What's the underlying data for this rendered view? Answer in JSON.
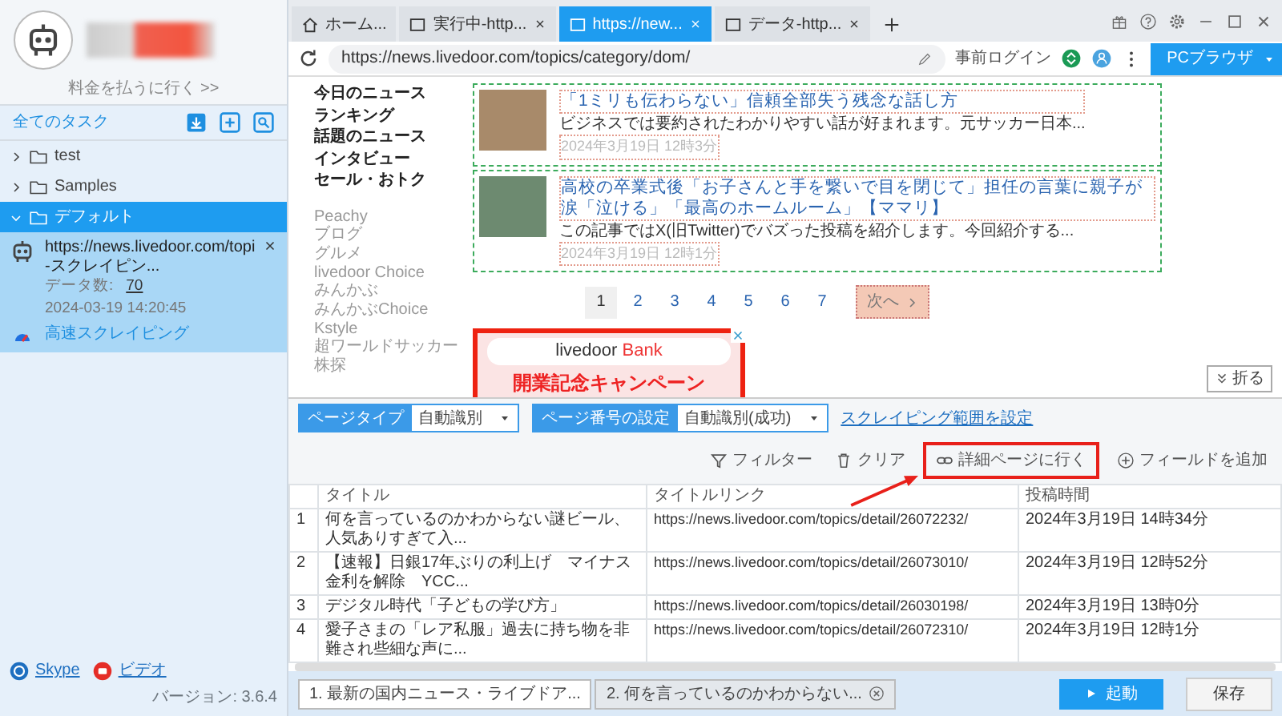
{
  "sidebar": {
    "pay_link": "料金を払うに行く >>",
    "all_tasks": "全てのタスク",
    "folders": [
      {
        "name": "test",
        "expanded": false,
        "selected": false
      },
      {
        "name": "Samples",
        "expanded": false,
        "selected": false
      },
      {
        "name": "デフォルト",
        "expanded": true,
        "selected": true,
        "tasks": [
          {
            "title": "https://news.livedoor.com/topi-スクレイピン...",
            "data_label": "データ数:",
            "data_count": "70",
            "time": "2024-03-19 14:20:45",
            "mode": "高速スクレイピング"
          }
        ]
      }
    ],
    "footer_links": [
      {
        "kind": "skype",
        "label": "Skype"
      },
      {
        "kind": "video",
        "label": "ビデオ"
      }
    ],
    "version": "バージョン: 3.6.4"
  },
  "browser_tabs": [
    {
      "kind": "home",
      "label": "ホーム...",
      "selected": false,
      "closable": false
    },
    {
      "kind": "page",
      "label": "実行中-http...",
      "selected": false,
      "closable": true
    },
    {
      "kind": "page",
      "label": "https://new...",
      "selected": true,
      "closable": true
    },
    {
      "kind": "page",
      "label": "データ-http...",
      "selected": false,
      "closable": true
    }
  ],
  "address_bar": {
    "url": "https://news.livedoor.com/topics/category/dom/",
    "prelogin": "事前ログイン",
    "browser_button": "PCブラウザ"
  },
  "webpage": {
    "nav_main": [
      "今日のニュース",
      "ランキング",
      "話題のニュース",
      "インタビュー",
      "セール・おトク"
    ],
    "nav_sub": [
      "Peachy",
      "ブログ",
      "グルメ",
      "livedoor Choice",
      "みんかぶ",
      "みんかぶChoice",
      "Kstyle",
      "超ワールドサッカー",
      "株探"
    ],
    "articles": [
      {
        "title": "「1ミリも伝わらない」信頼全部失う残念な話し方",
        "snippet": "ビジネスでは要約されたわかりやすい話が好まれます。元サッカー日本...",
        "date": "2024年3月19日 12時3分"
      },
      {
        "title": "高校の卒業式後「お子さんと手を繋いで目を閉じて」担任の言葉に親子が涙「泣ける」「最高のホームルーム」【ママリ】",
        "snippet": "この記事ではX(旧Twitter)でバズった投稿を紹介します。今回紹介する...",
        "date": "2024年3月19日 12時1分"
      }
    ],
    "pagination": {
      "pages": [
        {
          "label": "1",
          "selected": true
        },
        {
          "label": "2",
          "selected": false
        },
        {
          "label": "3",
          "selected": false
        },
        {
          "label": "4",
          "selected": false
        },
        {
          "label": "5",
          "selected": false
        },
        {
          "label": "6",
          "selected": false
        },
        {
          "label": "7",
          "selected": false
        }
      ],
      "next": "次へ"
    },
    "ad": {
      "brand_left": "livedoor",
      "brand_right": "Bank",
      "headline": "開業記念キャンペーン"
    }
  },
  "collapse_button": "折る",
  "toolbar": {
    "selects": [
      {
        "label": "ページタイプ",
        "value": "自動識別"
      },
      {
        "label": "ページ番号の設定",
        "value": "自動識別(成功)"
      }
    ],
    "range_link": "スクレイピング範囲を設定",
    "actions": [
      {
        "kind": "filter",
        "label": "フィルター",
        "highlighted": false
      },
      {
        "kind": "clear",
        "label": "クリア",
        "highlighted": false
      },
      {
        "kind": "detail",
        "label": "詳細ページに行く",
        "highlighted": true
      },
      {
        "kind": "add_field",
        "label": "フィールドを追加",
        "highlighted": false
      }
    ]
  },
  "table": {
    "columns": [
      "タイトル",
      "タイトルリンク",
      "投稿時間"
    ],
    "rows": [
      {
        "index": "1",
        "title": "何を言っているのかわからない謎ビール、人気ありすぎて入...",
        "link": "https://news.livedoor.com/topics/detail/26072232/",
        "time": "2024年3月19日 14時34分"
      },
      {
        "index": "2",
        "title": "【速報】日銀17年ぶりの利上げ　マイナス金利を解除　YCC...",
        "link": "https://news.livedoor.com/topics/detail/26073010/",
        "time": "2024年3月19日 12時52分"
      },
      {
        "index": "3",
        "title": "デジタル時代「子どもの学び方」",
        "link": "https://news.livedoor.com/topics/detail/26030198/",
        "time": "2024年3月19日 13時0分"
      },
      {
        "index": "4",
        "title": "愛子さまの「レア私服」過去に持ち物を非難され些細な声に...",
        "link": "https://news.livedoor.com/topics/detail/26072310/",
        "time": "2024年3月19日 12時1分"
      }
    ]
  },
  "result_tabs": [
    {
      "label": "1. 最新の国内ニュース・ライブドア...",
      "selected": true,
      "closable": false
    },
    {
      "label": "2. 何を言っているのかわからない...",
      "selected": false,
      "closable": true
    }
  ],
  "buttons": {
    "start": "起動",
    "save": "保存"
  }
}
